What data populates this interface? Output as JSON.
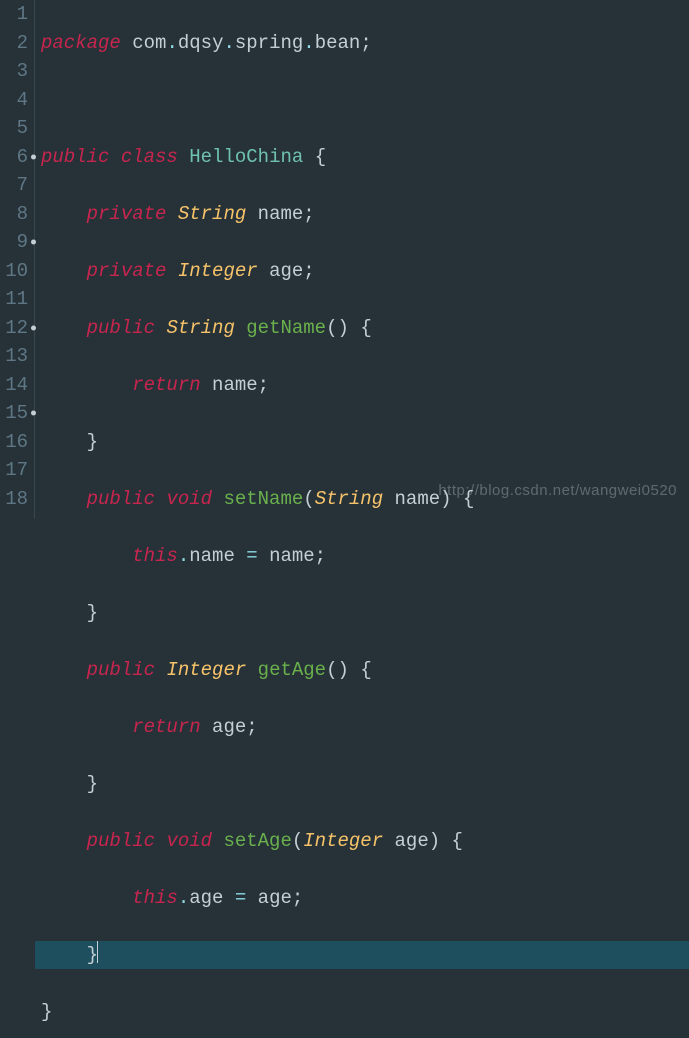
{
  "gutter": {
    "numbers": [
      "1",
      "2",
      "3",
      "4",
      "5",
      "6",
      "7",
      "8",
      "9",
      "10",
      "11",
      "12",
      "13",
      "14",
      "15",
      "16",
      "17",
      "18"
    ],
    "marks": [
      6,
      9,
      12,
      15
    ]
  },
  "code": {
    "l1": {
      "kw": "package",
      "p1": "com",
      "d": ".",
      "p2": "dqsy",
      "p3": "spring",
      "p4": "bean",
      "semi": ";"
    },
    "l2": {
      "blank": ""
    },
    "l3": {
      "kw1": "public",
      "kw2": "class",
      "cls": "HelloChina",
      "ob": "{"
    },
    "l4": {
      "kw": "private",
      "type": "String",
      "id": "name",
      "semi": ";"
    },
    "l5": {
      "kw": "private",
      "type": "Integer",
      "id": "age",
      "semi": ";"
    },
    "l6": {
      "kw": "public",
      "type": "String",
      "mth": "getName",
      "op": "()",
      "ob": "{"
    },
    "l7": {
      "kw": "return",
      "id": "name",
      "semi": ";"
    },
    "l8": {
      "cb": "}"
    },
    "l9": {
      "kw": "public",
      "vd": "void",
      "mth": "setName",
      "op1": "(",
      "ptype": "String",
      "pid": "name",
      "op2": ")",
      "ob": "{"
    },
    "l10": {
      "th": "this",
      "dot": ".",
      "f": "name",
      "eq": " = ",
      "id": "name",
      "semi": ";"
    },
    "l11": {
      "cb": "}"
    },
    "l12": {
      "kw": "public",
      "type": "Integer",
      "mth": "getAge",
      "op": "()",
      "ob": "{"
    },
    "l13": {
      "kw": "return",
      "id": "age",
      "semi": ";"
    },
    "l14": {
      "cb": "}"
    },
    "l15": {
      "kw": "public",
      "vd": "void",
      "mth": "setAge",
      "op1": "(",
      "ptype": "Integer",
      "pid": "age",
      "op2": ")",
      "ob": "{"
    },
    "l16": {
      "th": "this",
      "dot": ".",
      "f": "age",
      "eq": " = ",
      "id": "age",
      "semi": ";"
    },
    "l17": {
      "cb": "}"
    },
    "l18": {
      "cb": "}"
    }
  },
  "watermark": "http://blog.csdn.net/wangwei0520"
}
